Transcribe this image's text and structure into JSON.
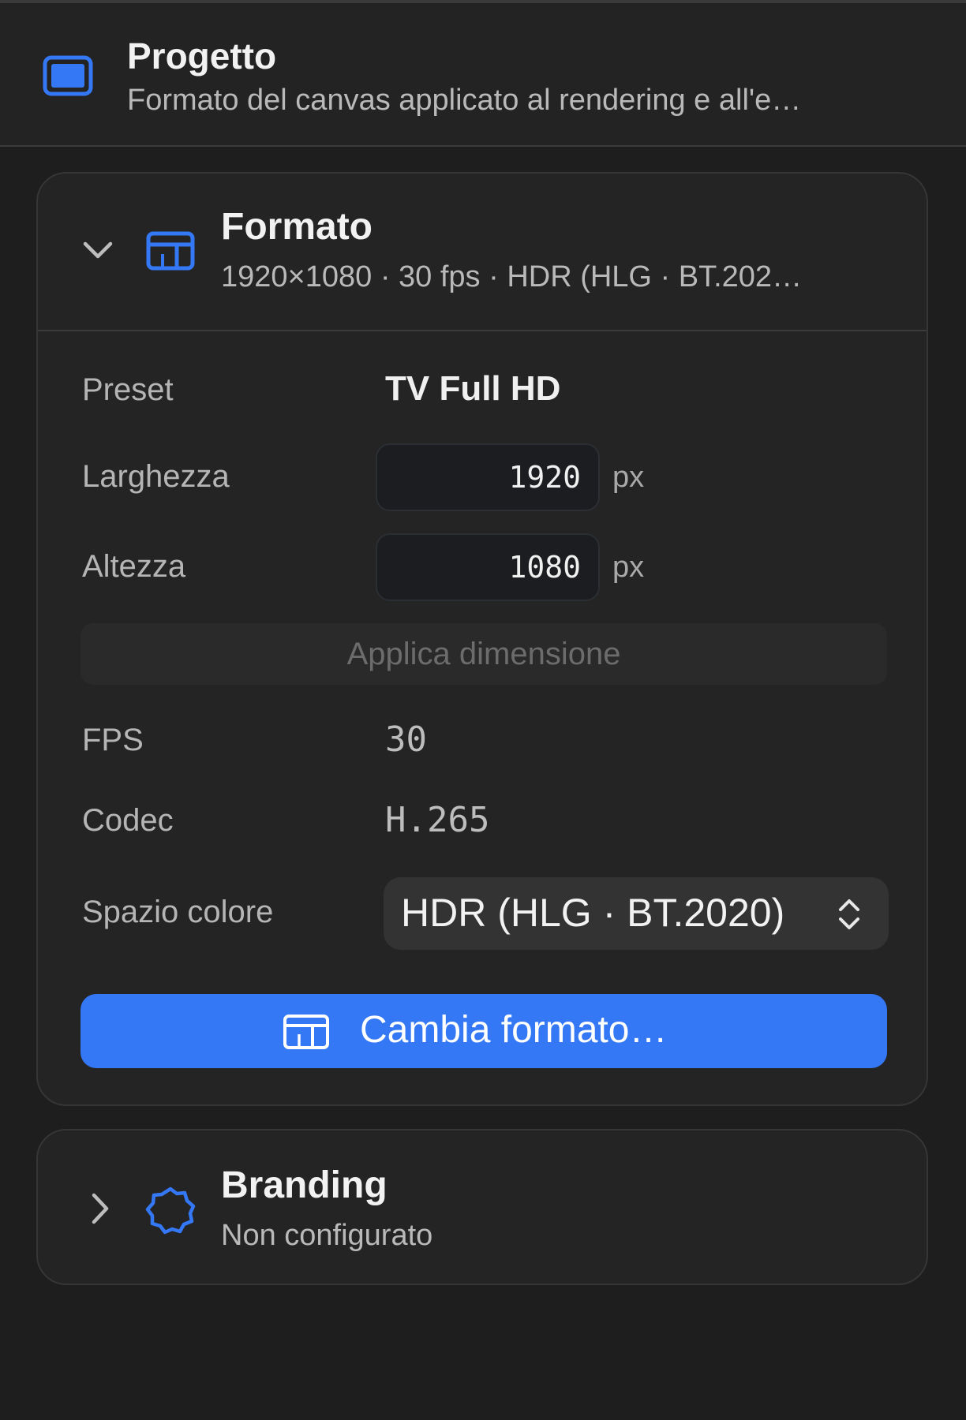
{
  "header": {
    "title": "Progetto",
    "subtitle": "Formato del canvas applicato al rendering e all'e…",
    "icon": "display-icon"
  },
  "format_section": {
    "title": "Formato",
    "summary": "1920×1080 · 30 fps · HDR (HLG · BT.202…",
    "expanded": true,
    "icon": "aspect-frame-icon",
    "preset": {
      "label": "Preset",
      "value": "TV Full HD"
    },
    "width": {
      "label": "Larghezza",
      "value": "1920",
      "unit": "px"
    },
    "height": {
      "label": "Altezza",
      "value": "1080",
      "unit": "px"
    },
    "apply_button": "Applica dimensione",
    "fps": {
      "label": "FPS",
      "value": "30"
    },
    "codec": {
      "label": "Codec",
      "value": "H.265"
    },
    "color_space": {
      "label": "Spazio colore",
      "value": "HDR (HLG · BT.2020)"
    },
    "change_button": "Cambia formato…"
  },
  "branding_section": {
    "title": "Branding",
    "summary": "Non configurato",
    "expanded": false,
    "icon": "seal-badge-icon"
  },
  "colors": {
    "accent": "#3478f6",
    "background": "#1e1e1e",
    "card": "#242424"
  }
}
